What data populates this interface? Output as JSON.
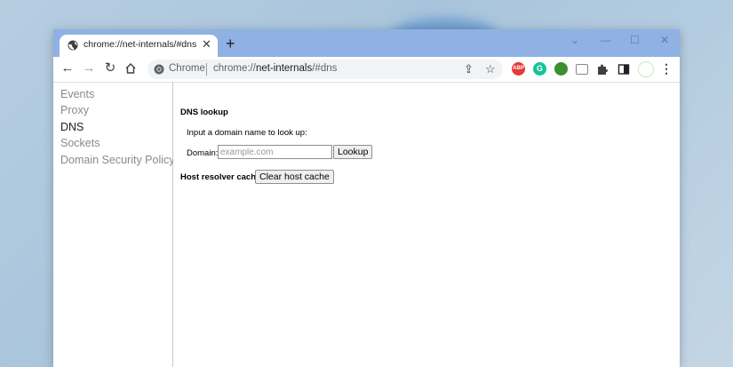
{
  "browser": {
    "tab_title": "chrome://net-internals/#dns",
    "omnibox_site": "Chrome",
    "omnibox_url_scheme": "chrome://",
    "omnibox_url_host": "net-internals",
    "omnibox_url_path": "/#dns",
    "icons": {
      "tab_favicon": "globe-icon",
      "tab_close": "close-icon",
      "new_tab": "plus-icon",
      "back": "arrow-left-icon",
      "forward": "arrow-right-icon",
      "reload": "reload-icon",
      "home": "home-icon",
      "share": "share-icon",
      "bookmark": "star-icon",
      "extensions": "puzzle-icon",
      "side_panel": "side-panel-icon",
      "menu": "kebab-menu-icon"
    },
    "extensions": [
      {
        "name": "abp-extension-icon",
        "text": "ABP",
        "color": "#e53935"
      },
      {
        "name": "grammarly-extension-icon",
        "text": "G",
        "color": "#15c39a"
      },
      {
        "name": "green-extension-icon",
        "text": "",
        "color": "#3b8f2e"
      },
      {
        "name": "cast-extension-icon",
        "text": "",
        "color": "#888888"
      },
      {
        "name": "profile-extension-icon",
        "text": "",
        "color": "#ffffff"
      }
    ]
  },
  "sidebar": {
    "items": [
      {
        "label": "Events",
        "active": false
      },
      {
        "label": "Proxy",
        "active": false
      },
      {
        "label": "DNS",
        "active": true
      },
      {
        "label": "Sockets",
        "active": false
      },
      {
        "label": "Domain Security Policy",
        "active": false
      }
    ]
  },
  "dns": {
    "heading": "DNS lookup",
    "instruction": "Input a domain name to look up:",
    "domain_label": "Domain:",
    "domain_placeholder": "example.com",
    "domain_value": "",
    "lookup_button": "Lookup",
    "cache_label": "Host resolver cache",
    "clear_cache_button": "Clear host cache"
  },
  "colors": {
    "titlebar": "#8fb1e3",
    "sidebar_text": "#8a8a8a",
    "sidebar_active_text": "#202124"
  }
}
